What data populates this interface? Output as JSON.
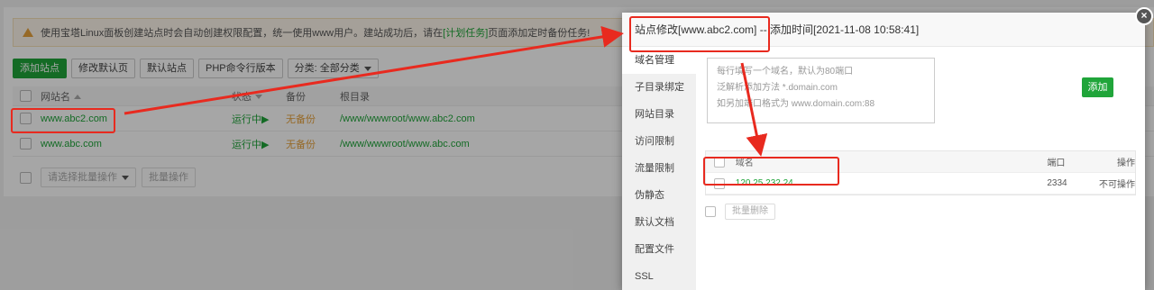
{
  "notice": {
    "text_before": "使用宝塔Linux面板创建站点时会自动创建权限配置，统一使用www用户。建站成功后，请在",
    "link": "[计划任务]",
    "text_after": "页面添加定时备份任务!"
  },
  "toolbar": {
    "add_site": "添加站点",
    "edit_default_page": "修改默认页",
    "default_site": "默认站点",
    "php_cli": "PHP命令行版本",
    "category": "分类: 全部分类"
  },
  "table": {
    "headers": {
      "name": "网站名",
      "status": "状态",
      "backup": "备份",
      "root": "根目录"
    },
    "rows": [
      {
        "name": "www.abc2.com",
        "status": "运行中▶",
        "backup": "无备份",
        "root": "/www/wwwroot/www.abc2.com"
      },
      {
        "name": "www.abc.com",
        "status": "运行中▶",
        "backup": "无备份",
        "root": "/www/wwwroot/www.abc.com"
      }
    ],
    "batch_select": "请选择批量操作",
    "batch_button": "批量操作"
  },
  "modal": {
    "title": "站点修改[www.abc2.com] -- 添加时间[2021-11-08 10:58:41]",
    "close": "×",
    "sidebar": [
      "域名管理",
      "子目录绑定",
      "网站目录",
      "访问限制",
      "流量限制",
      "伪静态",
      "默认文档",
      "配置文件",
      "SSL"
    ],
    "textarea_lines": [
      "每行填写一个域名，默认为80端口",
      "泛解析添加方法 *.domain.com",
      "如另加端口格式为 www.domain.com:88"
    ],
    "add_button": "添加",
    "domain_table": {
      "headers": {
        "domain": "域名",
        "port": "端口",
        "op": "操作"
      },
      "rows": [
        {
          "domain": "120.25.232.24",
          "port": "2334",
          "op": "不可操作"
        }
      ]
    },
    "batch_delete": "批量删除"
  },
  "colors": {
    "accent": "#20a53a",
    "annotation": "#e82a1f",
    "warning": "#e6a23c"
  }
}
